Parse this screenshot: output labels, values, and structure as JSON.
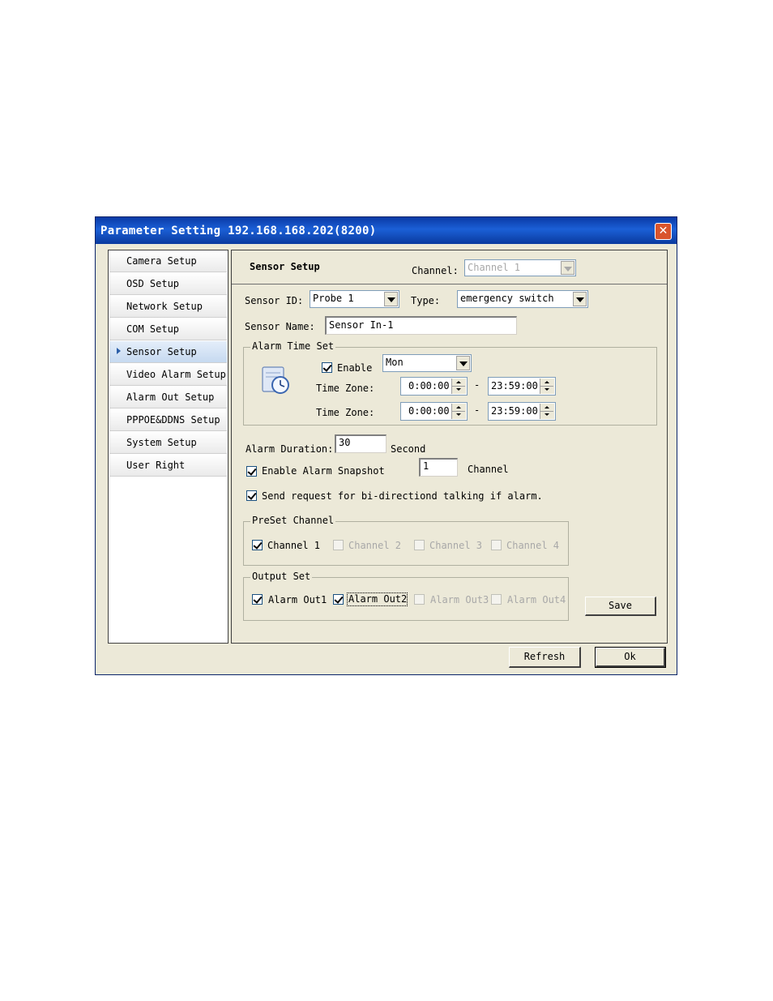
{
  "window": {
    "title": "Parameter Setting 192.168.168.202(8200)"
  },
  "sidebar": {
    "items": [
      {
        "label": "Camera Setup"
      },
      {
        "label": "OSD Setup"
      },
      {
        "label": "Network Setup"
      },
      {
        "label": "COM Setup"
      },
      {
        "label": "Sensor Setup",
        "active": true
      },
      {
        "label": "Video Alarm Setup"
      },
      {
        "label": "Alarm Out Setup"
      },
      {
        "label": "PPPOE&DDNS Setup"
      },
      {
        "label": "System Setup"
      },
      {
        "label": "User Right"
      }
    ]
  },
  "main": {
    "heading": "Sensor Setup",
    "channel_label": "Channel:",
    "channel_value": "Channel 1",
    "sensor_id_label": "Sensor ID:",
    "sensor_id_value": "Probe 1",
    "type_label": "Type:",
    "type_value": "emergency switch",
    "sensor_name_label": "Sensor Name:",
    "sensor_name_value": "Sensor In-1",
    "alarm_time_set": {
      "title": "Alarm Time Set",
      "enable_label": "Enable",
      "enable_checked": true,
      "day_value": "Mon",
      "time_zone_label": "Time Zone:",
      "zone1_start": "0:00:00",
      "zone1_end": "23:59:00",
      "zone2_start": "0:00:00",
      "zone2_end": "23:59:00",
      "separator": "-"
    },
    "alarm_duration_label": "Alarm Duration:",
    "alarm_duration_value": "30",
    "alarm_duration_unit": "Second",
    "snapshot_label": "Enable Alarm Snapshot",
    "snapshot_checked": true,
    "snapshot_channel_value": "1",
    "snapshot_channel_unit": "Channel",
    "talk_label": "Send request for bi-directiond talking if alarm.",
    "talk_checked": true,
    "preset_channel": {
      "title": "PreSet Channel",
      "items": [
        {
          "label": "Channel 1",
          "checked": true,
          "enabled": true
        },
        {
          "label": "Channel 2",
          "checked": false,
          "enabled": false
        },
        {
          "label": "Channel 3",
          "checked": false,
          "enabled": false
        },
        {
          "label": "Channel 4",
          "checked": false,
          "enabled": false
        }
      ]
    },
    "output_set": {
      "title": "Output Set",
      "items": [
        {
          "label": "Alarm Out1",
          "checked": true,
          "enabled": true
        },
        {
          "label": "Alarm Out2",
          "checked": true,
          "enabled": true
        },
        {
          "label": "Alarm Out3",
          "checked": false,
          "enabled": false
        },
        {
          "label": "Alarm Out4",
          "checked": false,
          "enabled": false
        }
      ]
    },
    "save_label": "Save"
  },
  "footer": {
    "refresh_label": "Refresh",
    "ok_label": "Ok"
  }
}
